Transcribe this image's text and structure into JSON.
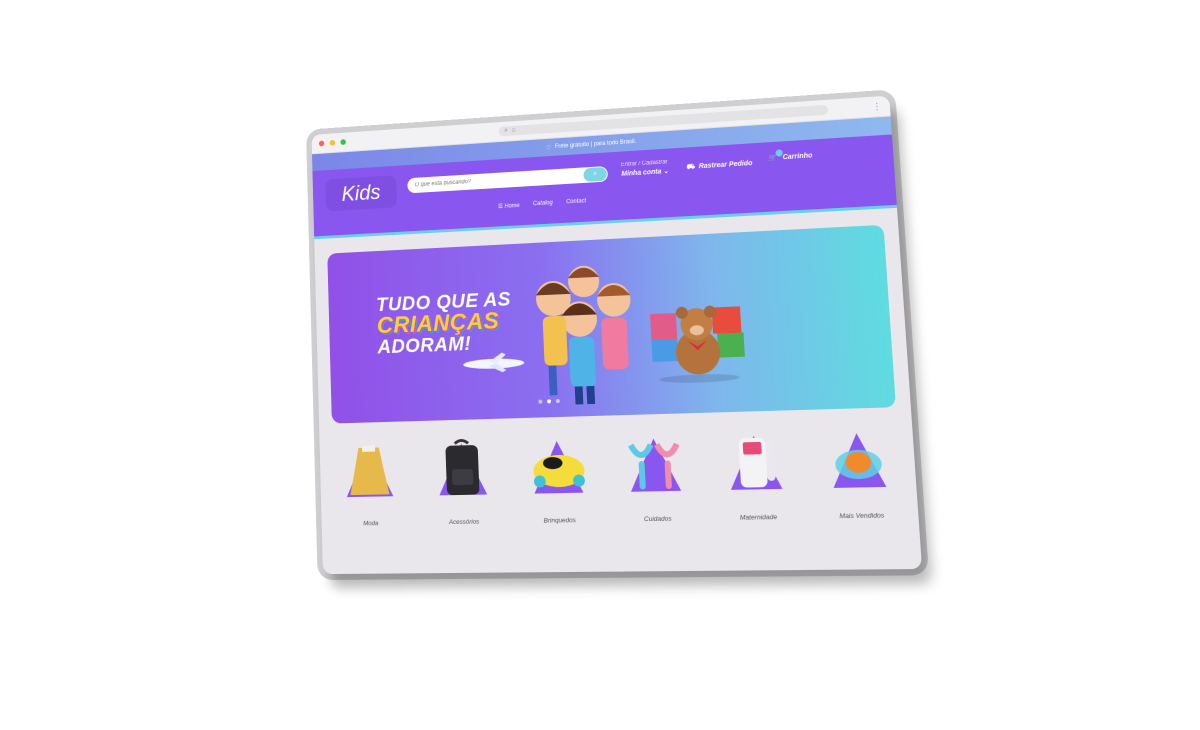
{
  "top_banner": {
    "text": "Frete gratuito | para todo Brasil."
  },
  "header": {
    "logo": "Kids",
    "search_placeholder": "O que está buscando?",
    "login_text": "Entrar / Cadastrar",
    "account_label": "Minha conta",
    "track_label": "Rastrear Pedido",
    "cart_label": "Carrinho"
  },
  "nav": {
    "items": [
      "Home",
      "Catalog",
      "Contact"
    ]
  },
  "hero": {
    "line1": "TUDO QUE AS",
    "line2": "CRIANÇAS",
    "line3": "ADORAM!",
    "active_slide": 2,
    "slide_count": 3
  },
  "categories": [
    {
      "label": "Moda",
      "icon": "dress-icon"
    },
    {
      "label": "Acessórios",
      "icon": "backpack-icon"
    },
    {
      "label": "Brinquedos",
      "icon": "toy-car-icon"
    },
    {
      "label": "Cuidados",
      "icon": "toothbrush-icon"
    },
    {
      "label": "Maternidade",
      "icon": "doppler-icon"
    },
    {
      "label": "Mais Vendidos",
      "icon": "bowl-icon"
    }
  ],
  "colors": {
    "primary": "#8a56f0",
    "accent": "#6ad0ea",
    "page_bg": "#e9e7ec"
  }
}
